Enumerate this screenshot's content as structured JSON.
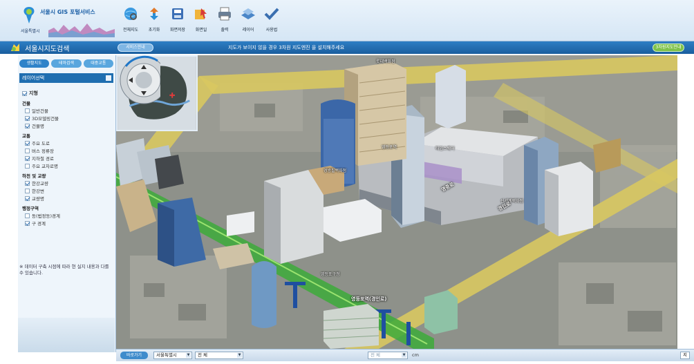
{
  "header": {
    "logo_title": "서울시 GIS 포털서비스",
    "logo_sub": "서울특별시",
    "toolbar": [
      {
        "icon": "globe-search-icon",
        "label": "전체지도"
      },
      {
        "icon": "refresh-icon",
        "label": "초기화"
      },
      {
        "icon": "save-screen-icon",
        "label": "화면저장"
      },
      {
        "icon": "pointer-icon",
        "label": "화면일"
      },
      {
        "icon": "print-icon",
        "label": "출력"
      },
      {
        "icon": "layer-icon",
        "label": "레이어"
      },
      {
        "icon": "checkmark-icon",
        "label": "사용법"
      }
    ]
  },
  "titlebar": {
    "title": "서울시지도검색",
    "pill": "서비스안내",
    "notice": "지도가 보이지 않을 경우 3차원 지도엔진 을 설치해주세요",
    "button": "3차원지도안내"
  },
  "sidebar": {
    "tabs": [
      "생활지도",
      "테마검색",
      "대중교통"
    ],
    "panel_title": "레이어선택",
    "layers": [
      {
        "label": "지형",
        "level": "root",
        "checked": true
      },
      {
        "label": "건물",
        "level": "group"
      },
      {
        "label": "일반건물",
        "level": "item",
        "checked": false
      },
      {
        "label": "3D모델링건물",
        "level": "item",
        "checked": true
      },
      {
        "label": "건물명",
        "level": "item",
        "checked": true
      },
      {
        "label": "교통",
        "level": "group"
      },
      {
        "label": "주요 도로",
        "level": "item",
        "checked": true
      },
      {
        "label": "버스 정류장",
        "level": "item",
        "checked": false
      },
      {
        "label": "지하철 경로",
        "level": "item",
        "checked": true
      },
      {
        "label": "주요 교차로명",
        "level": "item",
        "checked": false
      },
      {
        "label": "하천 및 교량",
        "level": "group"
      },
      {
        "label": "한강교량",
        "level": "item",
        "checked": true
      },
      {
        "label": "한강변",
        "level": "item",
        "checked": false
      },
      {
        "label": "교량명",
        "level": "item",
        "checked": true
      },
      {
        "label": "행정구역",
        "level": "group"
      },
      {
        "label": "동(법정동)경계",
        "level": "item",
        "checked": false
      },
      {
        "label": "구 경계",
        "level": "item",
        "checked": true
      }
    ],
    "note": "※ 데이터 구축 시점에 따라 현 실지 내용과 다를 수 있습니다."
  },
  "map": {
    "building_labels": [
      "롯데백화점",
      "영등포역",
      "타임스퀘어",
      "경방필백화점",
      "신세계백화점",
      "영등포구청"
    ],
    "road_labels": [
      "영등포역(경인로)",
      "영중로",
      "경인로"
    ]
  },
  "statusbar": {
    "button": "바로가기",
    "city": "서울특별시",
    "district": "전 체",
    "dong": "전 체",
    "unit": "cm",
    "right": "지"
  },
  "colors": {
    "header_bg": "#d5e6f5",
    "titlebar_bg": "#1a5e9e",
    "accent_green": "#7ec24a",
    "road_yellow": "#e8d66a",
    "subway_green": "#3daa3a"
  }
}
